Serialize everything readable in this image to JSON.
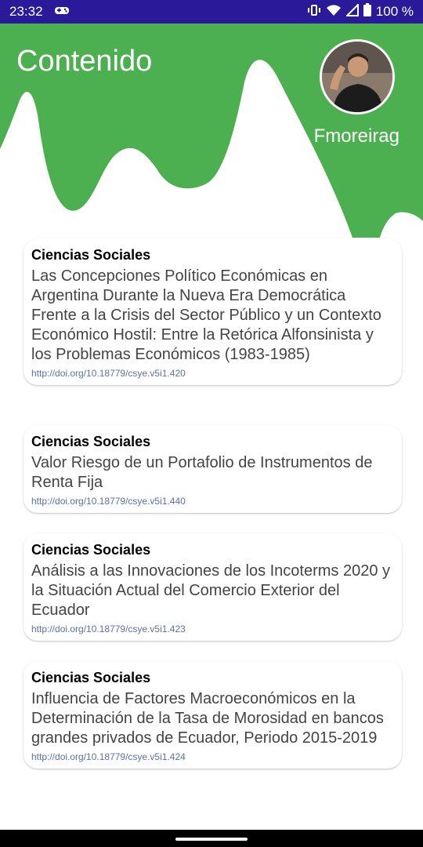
{
  "status_bar": {
    "time": "23:32",
    "battery": "100 %",
    "icons": [
      "game-controller-icon",
      "vibrate-icon",
      "wifi-icon",
      "cellular-icon",
      "battery-icon"
    ]
  },
  "header": {
    "title": "Contenido",
    "username": "Fmoreirag",
    "accent_color": "#4caf50"
  },
  "articles": [
    {
      "category": "Ciencias Sociales",
      "title": "Las Concepciones Político Económicas en Argentina Durante la Nueva Era Democrática Frente a la Crisis del Sector Público y un Contexto Económico Hostil: Entre la Retórica Alfonsinista y los Problemas Económicos (1983-1985)",
      "link": "http://doi.org/10.18779/csye.v5i1.420"
    },
    {
      "category": "Ciencias Sociales",
      "title": "Valor Riesgo de un Portafolio de Instrumentos de Renta Fija",
      "link": "http://doi.org/10.18779/csye.v5i1.440"
    },
    {
      "category": "Ciencias Sociales",
      "title": "Análisis a las Innovaciones de los Incoterms 2020 y la Situación Actual del Comercio Exterior del Ecuador",
      "link": "http://doi.org/10.18779/csye.v5i1.423"
    },
    {
      "category": "Ciencias Sociales",
      "title": "Influencia de Factores Macroeconómicos en la Determinación de la Tasa de Morosidad en bancos grandes privados de Ecuador, Periodo 2015-2019",
      "link": "http://doi.org/10.18779/csye.v5i1.424"
    }
  ]
}
